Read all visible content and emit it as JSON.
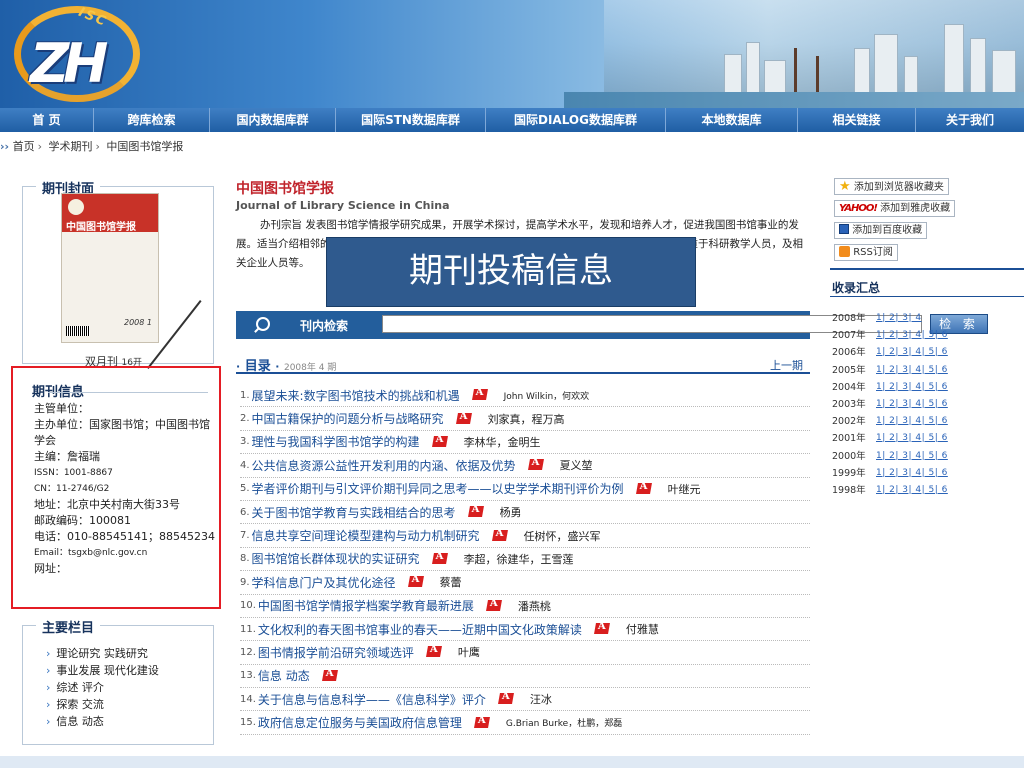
{
  "nav": [
    "首 页",
    "跨库检索",
    "国内数据库群",
    "国际STN数据库群",
    "国际DIALOG数据库群",
    "本地数据库",
    "相关链接",
    "关于我们"
  ],
  "breadcrumb": {
    "arrow": "››",
    "home": "首页",
    "level2": "学术期刊",
    "current": "中国图书馆学报"
  },
  "left": {
    "cover_title": "期刊封面",
    "cover_caption": "双月刊",
    "cover_format": "16开",
    "cover_mast": "中国图书馆学报",
    "cover_year": "2008  1",
    "info_title": "期刊信息",
    "info": {
      "sponsor": "主管单位：",
      "organizer": "主办单位：国家图书馆；中国图书馆学会",
      "editor": "主编：詹福瑞",
      "issn": "ISSN：1001-8867",
      "cn": "CN：11-2746/G2",
      "address": "地址：北京中关村南大街33号",
      "postcode": "邮政编码：100081",
      "phone": "电话：010-88545141；88545234",
      "email": "Email：tsgxb@nlc.gov.cn",
      "website": "网址："
    },
    "sections_title": "主要栏目",
    "sections": [
      "理论研究 实践研究",
      "事业发展 现代化建设",
      "综述 评介",
      "探索 交流",
      "信息 动态"
    ]
  },
  "journal": {
    "title": "中国图书馆学报",
    "en": "Journal of Library Science in China",
    "desc": "办刊宗旨 发表图书馆学情报学研究成果，开展学术探讨，提高学术水平，发现和培养人才，促进我国图书馆事业的发展。适当介绍相邻的学科知识。读者对象为图书馆学情报学教育、科研工作者及高等院校师生，侧重于科研教学人员，及相关企业人员等。",
    "popup": "期刊投稿信息"
  },
  "search": {
    "label": "刊内检索",
    "button": "检 索",
    "placeholder": ""
  },
  "toc": {
    "head": "目录",
    "dot": "·",
    "year_label": "2008年 4 期",
    "prev": "上一期",
    "items": [
      {
        "num": "1.",
        "title": "展望未来:数字图书馆技术的挑战和机遇",
        "authors": "John Wilkin，何欢欢"
      },
      {
        "num": "2.",
        "title": "中国古籍保护的问题分析与战略研究",
        "authors": "刘家真，程万高"
      },
      {
        "num": "3.",
        "title": "理性与我国科学图书馆学的构建",
        "authors": "李林华，金明生"
      },
      {
        "num": "4.",
        "title": "公共信息资源公益性开发利用的内涵、依据及优势",
        "authors": "夏义堃"
      },
      {
        "num": "5.",
        "title": "学者评价期刊与引文评价期刊异同之思考——以史学学术期刊评价为例",
        "authors": "叶继元"
      },
      {
        "num": "6.",
        "title": "关于图书馆学教育与实践相结合的思考",
        "authors": "杨勇"
      },
      {
        "num": "7.",
        "title": "信息共享空间理论模型建构与动力机制研究",
        "authors": "任树怀，盛兴军"
      },
      {
        "num": "8.",
        "title": "图书馆馆长群体现状的实证研究",
        "authors": "李超，徐建华，王雪莲"
      },
      {
        "num": "9.",
        "title": "学科信息门户及其优化途径",
        "authors": "蔡蕾"
      },
      {
        "num": "10.",
        "title": "中国图书馆学情报学档案学教育最新进展",
        "authors": "潘燕桃"
      },
      {
        "num": "11.",
        "title": "文化权利的春天图书馆事业的春天——近期中国文化政策解读",
        "authors": "付雅慧"
      },
      {
        "num": "12.",
        "title": "图书情报学前沿研究领域选评",
        "authors": "叶鹰"
      },
      {
        "num": "13.",
        "title": "信息 动态",
        "authors": ""
      },
      {
        "num": "14.",
        "title": "关于信息与信息科学——《信息科学》评介",
        "authors": "汪冰"
      },
      {
        "num": "15.",
        "title": "政府信息定位服务与美国政府信息管理",
        "authors": "G.Brian Burke，杜鹏，郑磊"
      }
    ]
  },
  "right": {
    "fav": "添加到浏览器收藏夹",
    "yahoo_logo": "YAHOO!",
    "yahoo": "添加到雅虎收藏",
    "baidu": "添加到百度收藏",
    "rss": "RSS订阅",
    "collect_title": "收录汇总",
    "years": [
      {
        "year": "2008年",
        "issues": "1| 2| 3| 4"
      },
      {
        "year": "2007年",
        "issues": "1| 2| 3| 4| 5| 6"
      },
      {
        "year": "2006年",
        "issues": "1| 2| 3| 4| 5| 6"
      },
      {
        "year": "2005年",
        "issues": "1| 2| 3| 4| 5| 6"
      },
      {
        "year": "2004年",
        "issues": "1| 2| 3| 4| 5| 6"
      },
      {
        "year": "2003年",
        "issues": "1| 2| 3| 4| 5| 6"
      },
      {
        "year": "2002年",
        "issues": "1| 2| 3| 4| 5| 6"
      },
      {
        "year": "2001年",
        "issues": "1| 2| 3| 4| 5| 6"
      },
      {
        "year": "2000年",
        "issues": "1| 2| 3| 4| 5| 6"
      },
      {
        "year": "1999年",
        "issues": "1| 2| 3| 4| 5| 6"
      },
      {
        "year": "1998年",
        "issues": "1| 2| 3| 4| 5| 6"
      }
    ]
  },
  "colors": {
    "nav_blue": "#1f5ea4",
    "title_red": "#c0232b",
    "link_blue": "#1b4f96",
    "highlight_red": "#e41c24",
    "popup_blue": "#2f5a8e"
  }
}
